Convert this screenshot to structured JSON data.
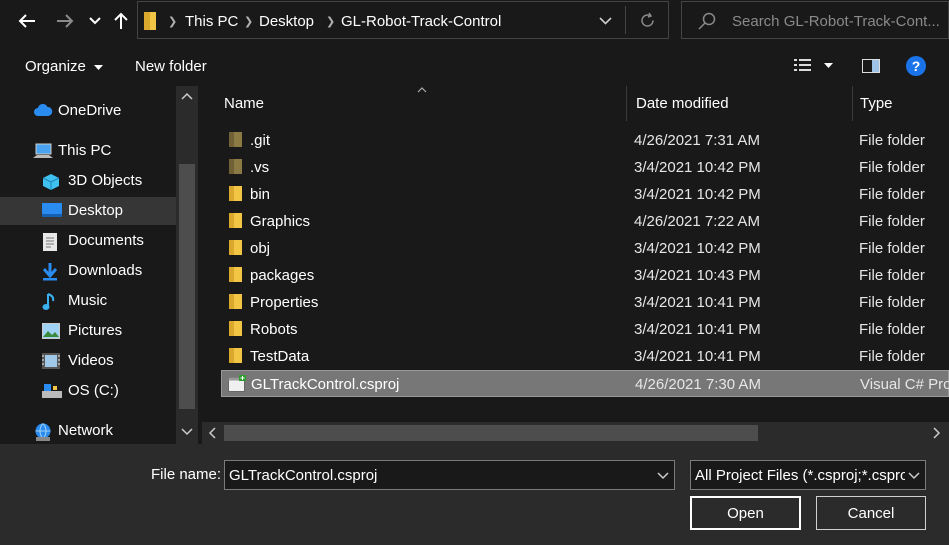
{
  "address": {
    "crumbs": [
      "This PC",
      "Desktop",
      "GL-Robot-Track-Control"
    ],
    "search_placeholder": "Search GL-Robot-Track-Cont..."
  },
  "toolbar": {
    "organize_label": "Organize",
    "new_folder_label": "New folder"
  },
  "nav": {
    "items": [
      {
        "label": "OneDrive",
        "icon": "cloud-icon"
      },
      {
        "label": "This PC",
        "icon": "computer-icon"
      },
      {
        "label": "3D Objects",
        "icon": "cube-icon"
      },
      {
        "label": "Desktop",
        "icon": "desktop-icon",
        "selected": true
      },
      {
        "label": "Documents",
        "icon": "document-icon"
      },
      {
        "label": "Downloads",
        "icon": "download-icon"
      },
      {
        "label": "Music",
        "icon": "music-icon"
      },
      {
        "label": "Pictures",
        "icon": "picture-icon"
      },
      {
        "label": "Videos",
        "icon": "video-icon"
      },
      {
        "label": "OS (C:)",
        "icon": "drive-icon"
      },
      {
        "label": "Network",
        "icon": "network-icon"
      }
    ]
  },
  "columns": {
    "name": "Name",
    "date": "Date modified",
    "type": "Type"
  },
  "files": [
    {
      "name": ".git",
      "date": "4/26/2021 7:31 AM",
      "type": "File folder",
      "kind": "folder-hidden"
    },
    {
      "name": ".vs",
      "date": "3/4/2021 10:42 PM",
      "type": "File folder",
      "kind": "folder-hidden"
    },
    {
      "name": "bin",
      "date": "3/4/2021 10:42 PM",
      "type": "File folder",
      "kind": "folder"
    },
    {
      "name": "Graphics",
      "date": "4/26/2021 7:22 AM",
      "type": "File folder",
      "kind": "folder"
    },
    {
      "name": "obj",
      "date": "3/4/2021 10:42 PM",
      "type": "File folder",
      "kind": "folder"
    },
    {
      "name": "packages",
      "date": "3/4/2021 10:43 PM",
      "type": "File folder",
      "kind": "folder"
    },
    {
      "name": "Properties",
      "date": "3/4/2021 10:41 PM",
      "type": "File folder",
      "kind": "folder"
    },
    {
      "name": "Robots",
      "date": "3/4/2021 10:41 PM",
      "type": "File folder",
      "kind": "folder"
    },
    {
      "name": "TestData",
      "date": "3/4/2021 10:41 PM",
      "type": "File folder",
      "kind": "folder"
    },
    {
      "name": "GLTrackControl.csproj",
      "date": "4/26/2021 7:30 AM",
      "type": "Visual C# Pro",
      "kind": "csproj",
      "selected": true
    }
  ],
  "bottom": {
    "file_name_label": "File name:",
    "file_name_value": "GLTrackControl.csproj",
    "filter_value": "All Project Files (*.csproj;*.cspro",
    "open_label": "Open",
    "cancel_label": "Cancel"
  },
  "colors": {
    "folder": "#f3c545",
    "folder_hidden": "#8c7a45",
    "accent": "#1a73e8",
    "selected_row": "#777777"
  }
}
